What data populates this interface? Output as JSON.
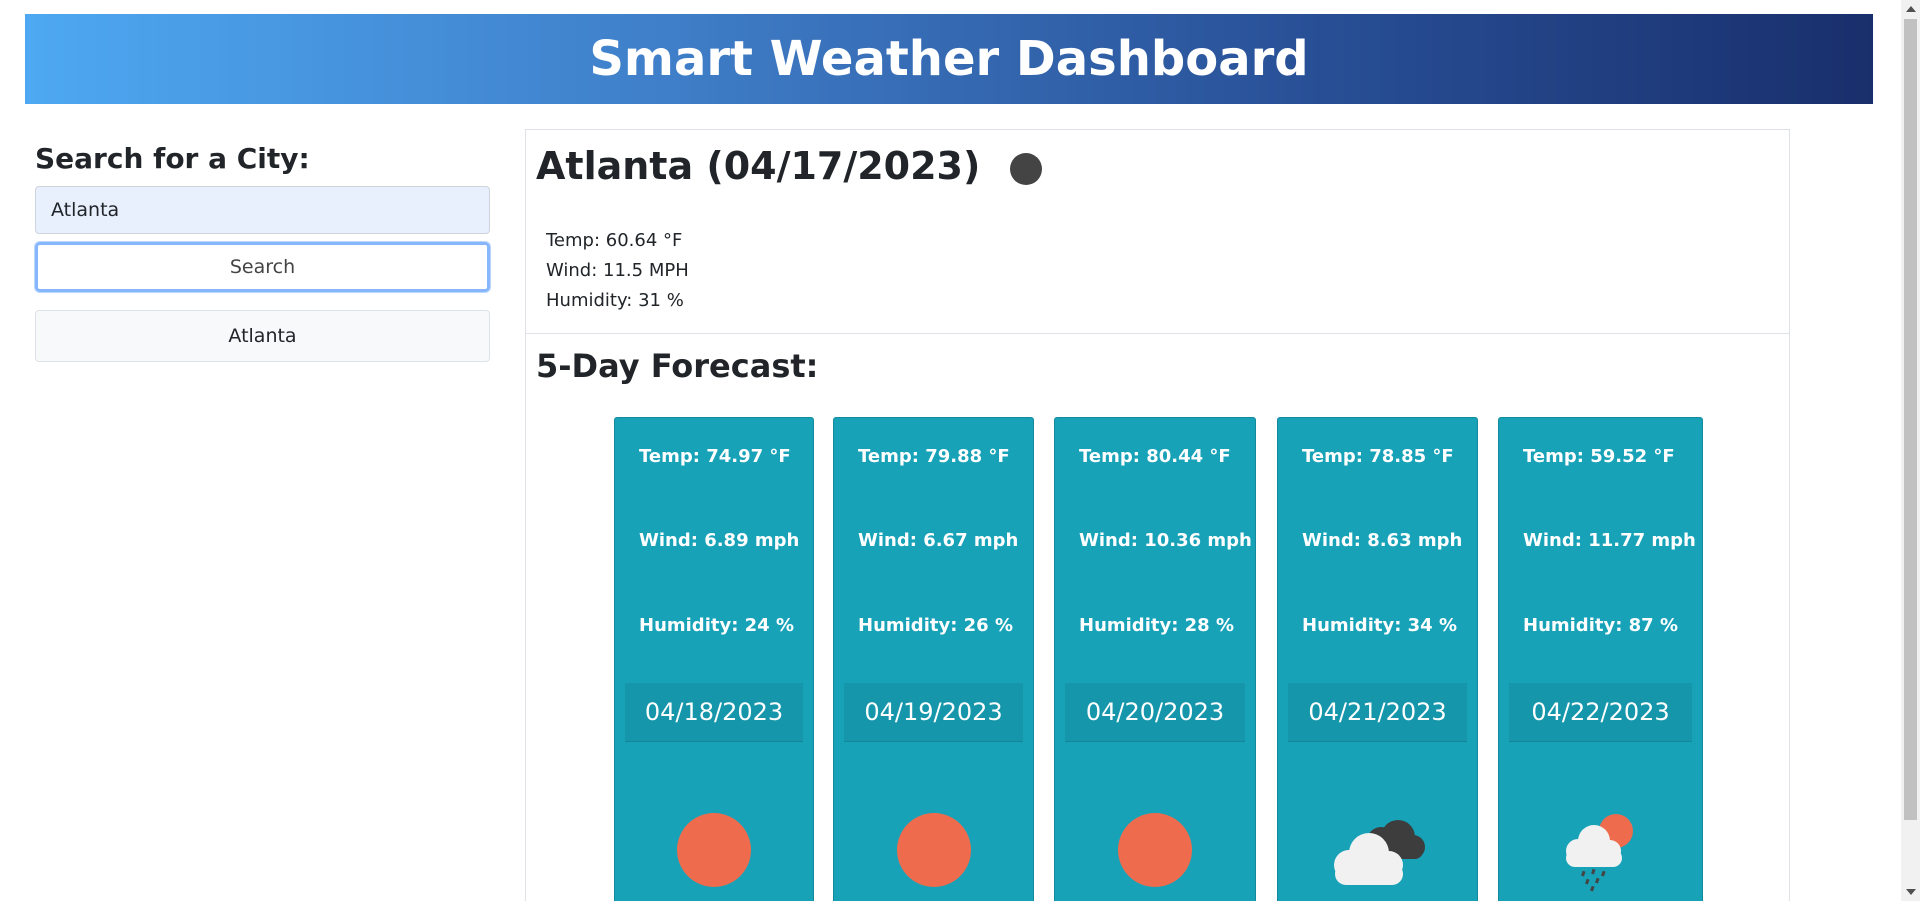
{
  "header": {
    "title": "Smart Weather Dashboard"
  },
  "sidebar": {
    "heading": "Search for a City:",
    "search_value": "Atlanta",
    "search_button_label": "Search",
    "history": [
      "Atlanta"
    ]
  },
  "current": {
    "title": "Atlanta (04/17/2023)",
    "icon": "dark-circle-icon",
    "temp": "Temp: 60.64 °F",
    "wind": "Wind: 11.5 MPH",
    "humidity": "Humidity: 31 %"
  },
  "forecast": {
    "heading": "5-Day Forecast:",
    "days": [
      {
        "temp": "Temp: 74.97 °F",
        "wind": "Wind: 6.89 mph",
        "humidity": "Humidity: 24 %",
        "date": "04/18/2023",
        "icon": "sun-icon"
      },
      {
        "temp": "Temp: 79.88 °F",
        "wind": "Wind: 6.67 mph",
        "humidity": "Humidity: 26 %",
        "date": "04/19/2023",
        "icon": "sun-icon"
      },
      {
        "temp": "Temp: 80.44 °F",
        "wind": "Wind: 10.36 mph",
        "humidity": "Humidity: 28 %",
        "date": "04/20/2023",
        "icon": "sun-icon"
      },
      {
        "temp": "Temp: 78.85 °F",
        "wind": "Wind: 8.63 mph",
        "humidity": "Humidity: 34 %",
        "date": "04/21/2023",
        "icon": "clouds-icon"
      },
      {
        "temp": "Temp: 59.52 °F",
        "wind": "Wind: 11.77 mph",
        "humidity": "Humidity: 87 %",
        "date": "04/22/2023",
        "icon": "rain-sun-cloud-icon"
      }
    ]
  },
  "colors": {
    "card": "#17a2b8",
    "sun": "#ee6c4d",
    "header_start": "#4ea8f2",
    "header_end": "#192f6c"
  }
}
